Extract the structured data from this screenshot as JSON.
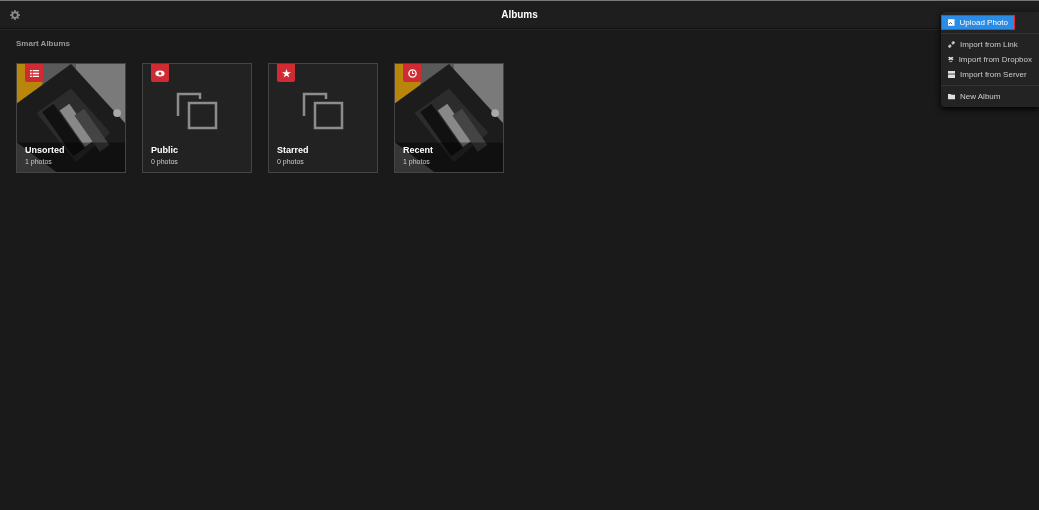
{
  "header": {
    "title": "Albums"
  },
  "section": {
    "title": "Smart Albums"
  },
  "albums": [
    {
      "title": "Unsorted",
      "count": "1 photos",
      "kind": "picture"
    },
    {
      "title": "Public",
      "count": "0 photos",
      "kind": "empty"
    },
    {
      "title": "Starred",
      "count": "0 photos",
      "kind": "empty"
    },
    {
      "title": "Recent",
      "count": "1 photos",
      "kind": "picture"
    }
  ],
  "menu": {
    "groups": [
      [
        {
          "label": "Upload Photo",
          "selected": true
        }
      ],
      [
        {
          "label": "Import from Link",
          "selected": false
        },
        {
          "label": "Import from Dropbox",
          "selected": false
        },
        {
          "label": "Import from Server",
          "selected": false
        }
      ],
      [
        {
          "label": "New Album",
          "selected": false
        }
      ]
    ]
  }
}
